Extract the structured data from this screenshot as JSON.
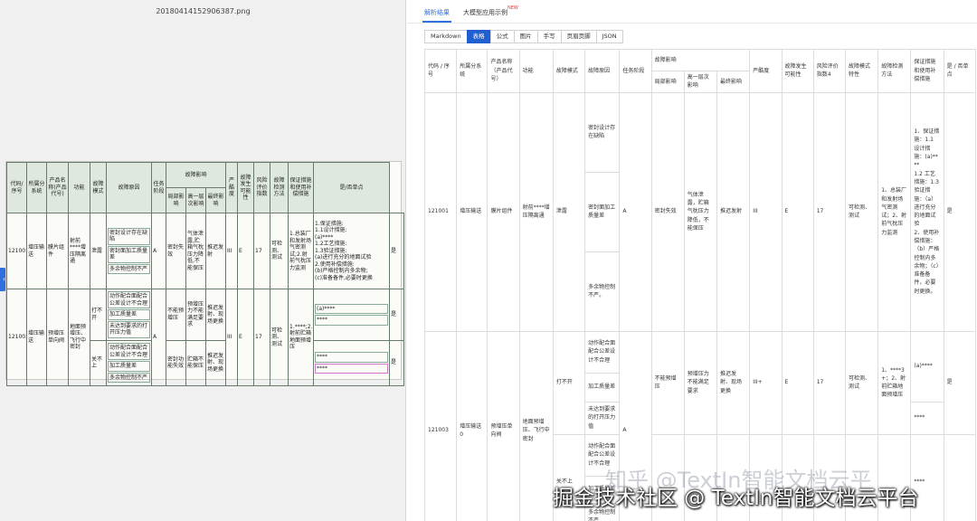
{
  "left": {
    "file_title": "20180414152906387.png",
    "collapse_icon": "chevron-left-icon",
    "scan": {
      "headers": [
        "代码/序号",
        "所属分系统",
        "产品名称(产品代号)",
        "功能",
        "故障模式",
        "故障原因",
        "任务阶段",
        "故障影响",
        "严酷度",
        "故障发生可能性",
        "风险评价指数",
        "故障检测方法",
        "保证措施和使用补偿措施",
        "是/否单点"
      ],
      "effect_sub": [
        "局部影响",
        "高一层次影响",
        "最终影响"
      ],
      "row1": {
        "code": "121001",
        "system": "增压输送",
        "product": "膜片组件",
        "function": "射前****增压隔离通",
        "mode": "泄露",
        "causes": [
          "密封设计存在缺陷",
          "密封面加工质量差",
          "多余物控制不严"
        ],
        "phase": "A",
        "local": "密封失效",
        "higher": "气体泄露,贮箱气枕压力降低,不能保压",
        "final": "推迟发射",
        "severity": "III",
        "likelihood": "E",
        "rpn": "17",
        "detect": "可检测、测试",
        "check": "1.总装厂和发射场气密测试;2.射前气枕压力监测",
        "measures": [
          "1.保证措施:",
          "1.1设计措施:",
          "(a)****",
          "1.2工艺措施:",
          "1.3验证措施:",
          "(a)进行充分的地面试验",
          "2.使用补偿措施:",
          "(b)严格控制内多余物;",
          "(c)准备备件,必要时更换"
        ],
        "single": "是"
      },
      "row2": {
        "code": "121003",
        "system": "增压输送",
        "product": "预增压单向阀",
        "function": "地面预增压、飞行中密封",
        "open_mode": "打不开",
        "close_mode": "关不上",
        "open_causes": [
          "动作配合面配合公差设计不合理",
          "加工质量差",
          "未达到要求的打开压力值"
        ],
        "close_causes": [
          "动作配合面配合公差设计不合理",
          "加工质量差",
          "多余物控制不严"
        ],
        "phase": "A",
        "open_local": "不能预增压",
        "open_higher": "预增压力不能满足要求",
        "open_final": "推迟发射、现场更换",
        "close_local": "密封功能失效",
        "close_higher": "贮箱不能保压",
        "close_final": "推迟发射、现场更换",
        "severity": "III",
        "likelihood": "E",
        "rpn": "17",
        "detect": "可检测、测试",
        "check": "1.****;2.射前贮箱地面预增压",
        "measures_a": "(a)****",
        "measures_b": "****",
        "measures_c": "****",
        "measures_d": "****",
        "single": "是"
      }
    }
  },
  "right": {
    "top_tabs": [
      "解析结果",
      "大模型应用示例"
    ],
    "new_badge": "NEW",
    "format_tabs": [
      "Markdown",
      "表格",
      "公式",
      "图片",
      "手写",
      "页眉页脚",
      "JSON"
    ],
    "active_format": "表格",
    "table": {
      "headers": [
        "代码 / 序号",
        "所属分系统",
        "产品名称（产品代号）",
        "功能",
        "故障模式",
        "故障原因",
        "任务阶段",
        "故障影响",
        "严酷度",
        "故障发生可能性",
        "风险评价指数4",
        "故障模式特性",
        "故障检测方法",
        "保证措施和使用补偿措施",
        "是 / 否单点"
      ],
      "effect_sub": [
        "局部影响",
        "高一层次影响",
        "最终影响"
      ],
      "row1": {
        "code": "121001",
        "system": "增压输送",
        "product": "膜片组件",
        "function": "射前****增压隔离通",
        "mode": "泄露",
        "causes": [
          "密封设计存在缺陷",
          "密封面加工质量差",
          "多余物控制不严。"
        ],
        "phase": "A",
        "local": "密封失效",
        "higher": "气体泄露，贮箱气枕压力降低，不能保压",
        "final": "推迟发射",
        "severity": "III",
        "likelihood": "E",
        "rpn": "17",
        "trait": "可检测、测试",
        "check": "1、总装厂和发射场气密测试；2、射前气枕压力监测",
        "measures": [
          "1、保证措施：1.1 设计措施：(a)****",
          "1.2 工艺措施：1.3 验证措施：（a）进行充分的地面试验",
          "2、使用补偿措施：（b）严格控制内多余物；（c）准备备件，必要时更换。"
        ],
        "single": "是"
      },
      "row2": {
        "code": "121003",
        "system": "增压输送0",
        "product": "预增压单向阀",
        "function": "地面预增压、飞行中密封",
        "open_mode": "打不开",
        "close_mode": "关不上",
        "open_causes": [
          "动作配合面配合公差设计不合理",
          "加工质量差",
          "未达到要求的打开压力值"
        ],
        "close_causes": [
          "动作配合面配合公差设计不合理",
          "加工质量差",
          "多余物控制不严"
        ],
        "phase": "A",
        "open_local": "不能预增压",
        "open_higher": "预增压力不能满足要求",
        "open_final": "推迟发射、现场更换",
        "severity": "III+",
        "likelihood": "E",
        "rpn": "17",
        "trait": "可检测、测试",
        "check": "1、****3+；2、射前贮箱地面预增压",
        "measures_a": "(a)****",
        "measures_b": "****",
        "measures_c": "****",
        "single": "是"
      }
    }
  },
  "watermarks": [
    "知乎 @TextIn智能文档云平",
    "掘金技术社区 @ TextIn智能文档云平台"
  ]
}
